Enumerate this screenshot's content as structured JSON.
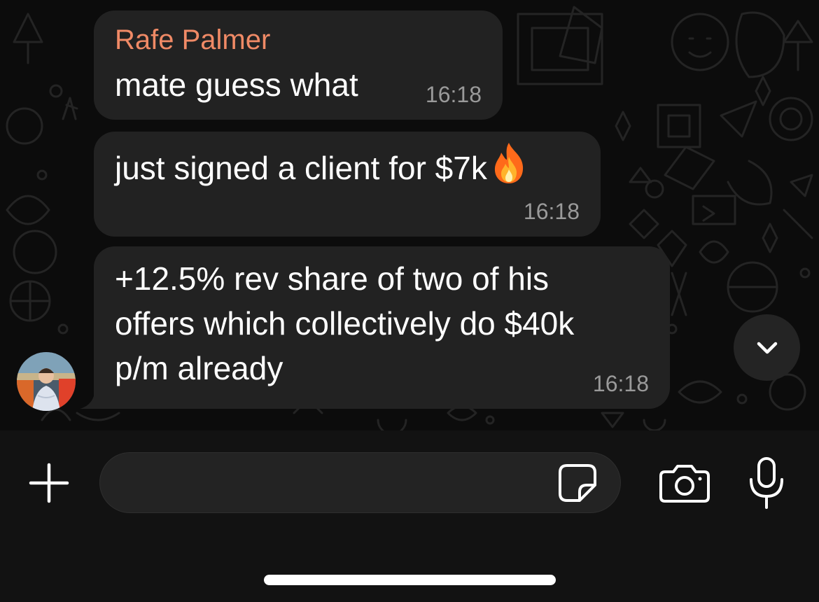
{
  "messages": [
    {
      "sender": "Rafe Palmer",
      "text": "mate guess what",
      "time": "16:18"
    },
    {
      "text": "just signed a client for $7k",
      "emoji": "fire-emoji",
      "time": "16:18"
    },
    {
      "text": "+12.5% rev share of two of his\noffers which collectively do $40k\np/m already",
      "time": "16:18"
    }
  ],
  "composer": {
    "placeholder": "",
    "value": ""
  },
  "icons": {
    "attach": "plus-icon",
    "sticker": "sticker-icon",
    "camera": "camera-icon",
    "mic": "microphone-icon",
    "scroll": "chevron-down-icon"
  },
  "colors": {
    "sender_name": "#f08a66",
    "bubble": "#222222",
    "background": "#0c0c0c",
    "timestamp": "#9a9a9a"
  }
}
